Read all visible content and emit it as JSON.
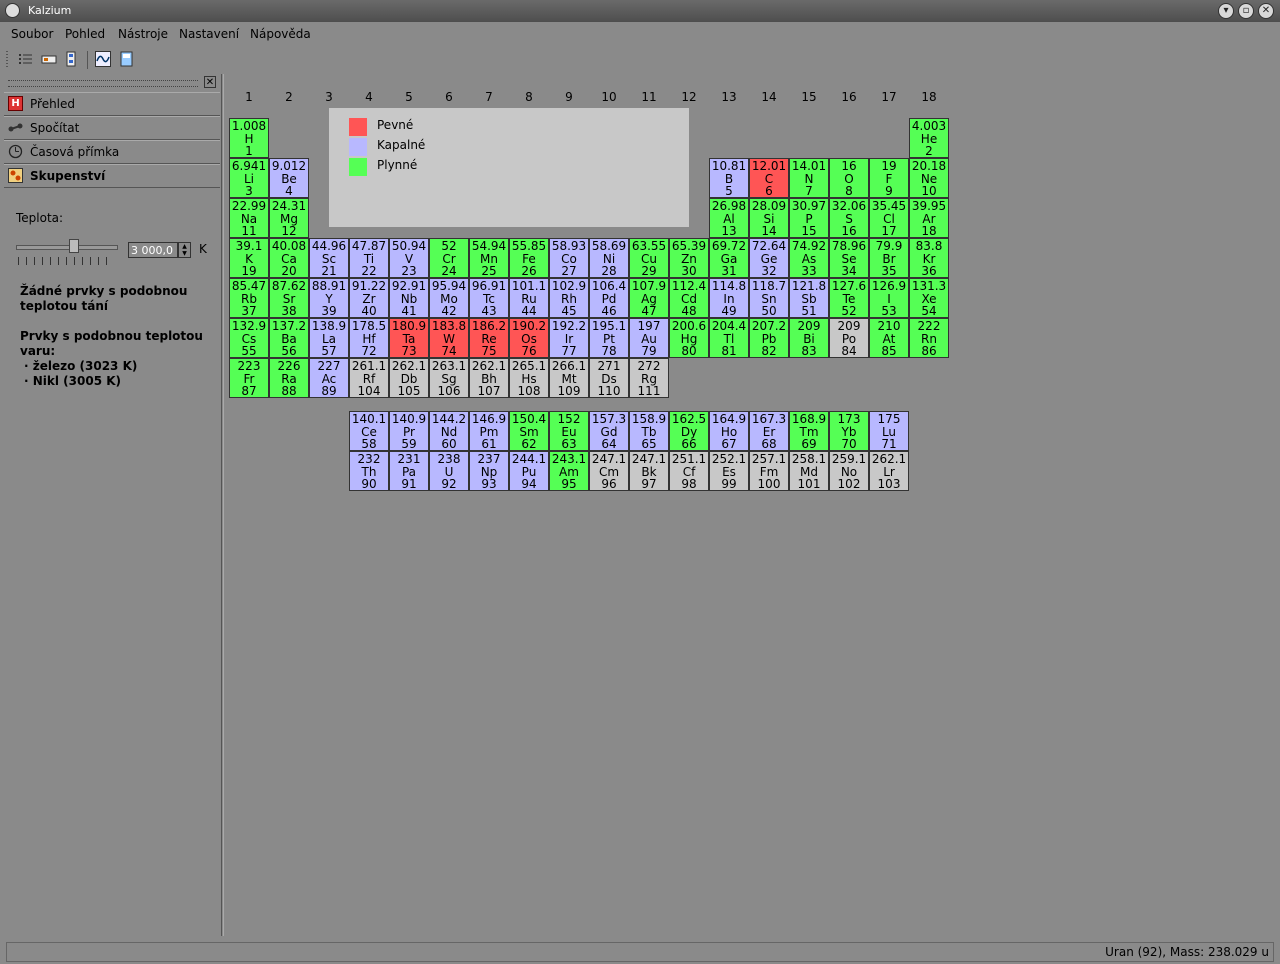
{
  "window": {
    "title": "Kalzium"
  },
  "menu": [
    "Soubor",
    "Pohled",
    "Nástroje",
    "Nastavení",
    "Nápověda"
  ],
  "sidebar": {
    "tabs": [
      {
        "label": "Přehled",
        "icon": "overview-icon"
      },
      {
        "label": "Spočítat",
        "icon": "calculate-icon"
      },
      {
        "label": "Časová přímka",
        "icon": "timeline-icon"
      },
      {
        "label": "Skupenství",
        "icon": "state-of-matter-icon"
      }
    ],
    "temperature_label": "Teplota:",
    "temperature_value": "3 000,0",
    "temperature_unit": "K",
    "melting_text_1": "Žádné prvky s podobnou",
    "melting_text_2": "teplotou tání",
    "boiling_text_1": "Prvky s podobnou teplotou",
    "boiling_text_2": "varu:",
    "boiling_item_1": "· železo (3023 K)",
    "boiling_item_2": "· Nikl (3005 K)"
  },
  "legend": [
    {
      "label": "Pevné",
      "color": "#ff5555"
    },
    {
      "label": "Kapalné",
      "color": "#b8b8ff"
    },
    {
      "label": "Plynné",
      "color": "#55ff55"
    }
  ],
  "colors": {
    "S": "#ff5555",
    "L": "#b8b8ff",
    "G": "#55ff55",
    "U": "#c8c8c8"
  },
  "groups": [
    "1",
    "2",
    "3",
    "4",
    "5",
    "6",
    "7",
    "8",
    "9",
    "10",
    "11",
    "12",
    "13",
    "14",
    "15",
    "16",
    "17",
    "18"
  ],
  "elements": [
    [
      "1.008",
      "H",
      "1",
      "G"
    ],
    [
      "4.003",
      "He",
      "2",
      "G"
    ],
    [
      "6.941",
      "Li",
      "3",
      "G"
    ],
    [
      "9.012",
      "Be",
      "4",
      "L"
    ],
    [
      "10.81",
      "B",
      "5",
      "L"
    ],
    [
      "12.01",
      "C",
      "6",
      "S"
    ],
    [
      "14.01",
      "N",
      "7",
      "G"
    ],
    [
      "16",
      "O",
      "8",
      "G"
    ],
    [
      "19",
      "F",
      "9",
      "G"
    ],
    [
      "20.18",
      "Ne",
      "10",
      "G"
    ],
    [
      "22.99",
      "Na",
      "11",
      "G"
    ],
    [
      "24.31",
      "Mg",
      "12",
      "G"
    ],
    [
      "26.98",
      "Al",
      "13",
      "G"
    ],
    [
      "28.09",
      "Si",
      "14",
      "G"
    ],
    [
      "30.97",
      "P",
      "15",
      "G"
    ],
    [
      "32.06",
      "S",
      "16",
      "G"
    ],
    [
      "35.45",
      "Cl",
      "17",
      "G"
    ],
    [
      "39.95",
      "Ar",
      "18",
      "G"
    ],
    [
      "39.1",
      "K",
      "19",
      "G"
    ],
    [
      "40.08",
      "Ca",
      "20",
      "G"
    ],
    [
      "44.96",
      "Sc",
      "21",
      "L"
    ],
    [
      "47.87",
      "Ti",
      "22",
      "L"
    ],
    [
      "50.94",
      "V",
      "23",
      "L"
    ],
    [
      "52",
      "Cr",
      "24",
      "G"
    ],
    [
      "54.94",
      "Mn",
      "25",
      "G"
    ],
    [
      "55.85",
      "Fe",
      "26",
      "G"
    ],
    [
      "58.93",
      "Co",
      "27",
      "L"
    ],
    [
      "58.69",
      "Ni",
      "28",
      "L"
    ],
    [
      "63.55",
      "Cu",
      "29",
      "G"
    ],
    [
      "65.39",
      "Zn",
      "30",
      "G"
    ],
    [
      "69.72",
      "Ga",
      "31",
      "G"
    ],
    [
      "72.64",
      "Ge",
      "32",
      "L"
    ],
    [
      "74.92",
      "As",
      "33",
      "G"
    ],
    [
      "78.96",
      "Se",
      "34",
      "G"
    ],
    [
      "79.9",
      "Br",
      "35",
      "G"
    ],
    [
      "83.8",
      "Kr",
      "36",
      "G"
    ],
    [
      "85.47",
      "Rb",
      "37",
      "G"
    ],
    [
      "87.62",
      "Sr",
      "38",
      "G"
    ],
    [
      "88.91",
      "Y",
      "39",
      "L"
    ],
    [
      "91.22",
      "Zr",
      "40",
      "L"
    ],
    [
      "92.91",
      "Nb",
      "41",
      "L"
    ],
    [
      "95.94",
      "Mo",
      "42",
      "L"
    ],
    [
      "96.91",
      "Tc",
      "43",
      "L"
    ],
    [
      "101.1",
      "Ru",
      "44",
      "L"
    ],
    [
      "102.9",
      "Rh",
      "45",
      "L"
    ],
    [
      "106.4",
      "Pd",
      "46",
      "L"
    ],
    [
      "107.9",
      "Ag",
      "47",
      "G"
    ],
    [
      "112.4",
      "Cd",
      "48",
      "G"
    ],
    [
      "114.8",
      "In",
      "49",
      "L"
    ],
    [
      "118.7",
      "Sn",
      "50",
      "L"
    ],
    [
      "121.8",
      "Sb",
      "51",
      "L"
    ],
    [
      "127.6",
      "Te",
      "52",
      "G"
    ],
    [
      "126.9",
      "I",
      "53",
      "G"
    ],
    [
      "131.3",
      "Xe",
      "54",
      "G"
    ],
    [
      "132.9",
      "Cs",
      "55",
      "G"
    ],
    [
      "137.2",
      "Ba",
      "56",
      "G"
    ],
    [
      "138.9",
      "La",
      "57",
      "L"
    ],
    [
      "178.5",
      "Hf",
      "72",
      "L"
    ],
    [
      "180.9",
      "Ta",
      "73",
      "S"
    ],
    [
      "183.8",
      "W",
      "74",
      "S"
    ],
    [
      "186.2",
      "Re",
      "75",
      "S"
    ],
    [
      "190.2",
      "Os",
      "76",
      "S"
    ],
    [
      "192.2",
      "Ir",
      "77",
      "L"
    ],
    [
      "195.1",
      "Pt",
      "78",
      "L"
    ],
    [
      "197",
      "Au",
      "79",
      "L"
    ],
    [
      "200.6",
      "Hg",
      "80",
      "G"
    ],
    [
      "204.4",
      "Tl",
      "81",
      "G"
    ],
    [
      "207.2",
      "Pb",
      "82",
      "G"
    ],
    [
      "209",
      "Bi",
      "83",
      "G"
    ],
    [
      "209",
      "Po",
      "84",
      "U"
    ],
    [
      "210",
      "At",
      "85",
      "G"
    ],
    [
      "222",
      "Rn",
      "86",
      "G"
    ],
    [
      "223",
      "Fr",
      "87",
      "G"
    ],
    [
      "226",
      "Ra",
      "88",
      "G"
    ],
    [
      "227",
      "Ac",
      "89",
      "L"
    ],
    [
      "261.1",
      "Rf",
      "104",
      "U"
    ],
    [
      "262.1",
      "Db",
      "105",
      "U"
    ],
    [
      "263.1",
      "Sg",
      "106",
      "U"
    ],
    [
      "262.1",
      "Bh",
      "107",
      "U"
    ],
    [
      "265.1",
      "Hs",
      "108",
      "U"
    ],
    [
      "266.1",
      "Mt",
      "109",
      "U"
    ],
    [
      "271",
      "Ds",
      "110",
      "U"
    ],
    [
      "272",
      "Rg",
      "111",
      "U"
    ],
    [
      "140.1",
      "Ce",
      "58",
      "L"
    ],
    [
      "140.9",
      "Pr",
      "59",
      "L"
    ],
    [
      "144.2",
      "Nd",
      "60",
      "L"
    ],
    [
      "146.9",
      "Pm",
      "61",
      "L"
    ],
    [
      "150.4",
      "Sm",
      "62",
      "G"
    ],
    [
      "152",
      "Eu",
      "63",
      "G"
    ],
    [
      "157.3",
      "Gd",
      "64",
      "L"
    ],
    [
      "158.9",
      "Tb",
      "65",
      "L"
    ],
    [
      "162.5",
      "Dy",
      "66",
      "G"
    ],
    [
      "164.9",
      "Ho",
      "67",
      "L"
    ],
    [
      "167.3",
      "Er",
      "68",
      "L"
    ],
    [
      "168.9",
      "Tm",
      "69",
      "G"
    ],
    [
      "173",
      "Yb",
      "70",
      "G"
    ],
    [
      "175",
      "Lu",
      "71",
      "L"
    ],
    [
      "232",
      "Th",
      "90",
      "L"
    ],
    [
      "231",
      "Pa",
      "91",
      "L"
    ],
    [
      "238",
      "U",
      "92",
      "L"
    ],
    [
      "237",
      "Np",
      "93",
      "L"
    ],
    [
      "244.1",
      "Pu",
      "94",
      "L"
    ],
    [
      "243.1",
      "Am",
      "95",
      "G"
    ],
    [
      "247.1",
      "Cm",
      "96",
      "U"
    ],
    [
      "247.1",
      "Bk",
      "97",
      "U"
    ],
    [
      "251.1",
      "Cf",
      "98",
      "U"
    ],
    [
      "252.1",
      "Es",
      "99",
      "U"
    ],
    [
      "257.1",
      "Fm",
      "100",
      "U"
    ],
    [
      "258.1",
      "Md",
      "101",
      "U"
    ],
    [
      "259.1",
      "No",
      "102",
      "U"
    ],
    [
      "262.1",
      "Lr",
      "103",
      "U"
    ]
  ],
  "status": "Uran (92), Mass: 238.029 u"
}
